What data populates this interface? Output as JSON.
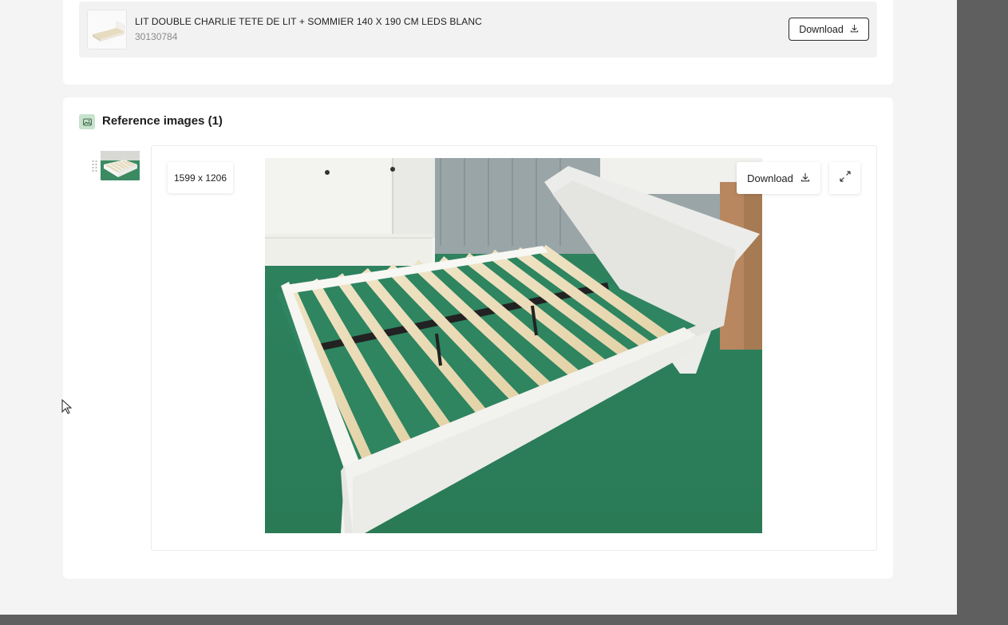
{
  "product": {
    "name": "LIT DOUBLE CHARLIE TETE DE LIT + SOMMIER 140 X 190 CM LEDS BLANC",
    "code": "30130784",
    "download_label": "Download"
  },
  "reference_images": {
    "title": "Reference images (1)",
    "dimensions": "1599 x 1206",
    "download_label": "Download"
  },
  "icons": [
    "image-icon",
    "download-icon",
    "expand-icon",
    "drag-handle-icon",
    "cursor-pointer-icon"
  ],
  "colors": {
    "accent_bg": "#c7e2cd",
    "overlay": "#5f5f5f"
  }
}
